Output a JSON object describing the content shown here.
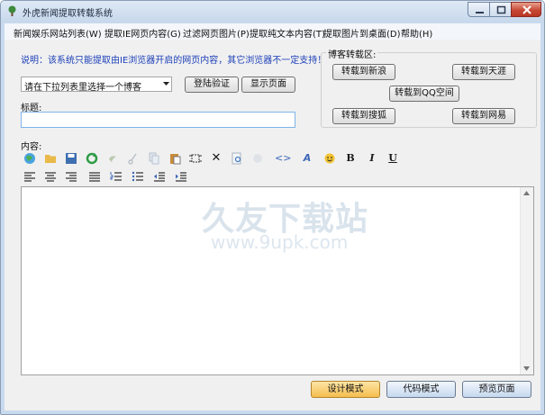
{
  "window": {
    "title": "外虎新闻提取转载系统",
    "accent_color": "#c9daee"
  },
  "menu": [
    "新闻娱乐网站列表(W)",
    "提取IE网页内容(G)",
    "过滤网页图片(P)",
    "提取纯文本内容(T)",
    "提取图片到桌面(D)",
    "帮助(H)"
  ],
  "notice": "说明：该系统只能提取由IE浏览器开启的网页内容，其它浏览器不一定支持！",
  "blog_select": {
    "selected": "请在下拉列表里选择一个博客"
  },
  "buttons": {
    "login_verify": "登陆验证",
    "show_page": "显示页面"
  },
  "title_label": "标题:",
  "title_value": "",
  "content_label": "内容:",
  "repost_group": {
    "title": "博客转载区:",
    "sina": "转载到新浪",
    "tianya": "转载到天涯",
    "qzone": "转载到QQ空间",
    "sohu": "转载到搜狐",
    "netease": "转载到网易"
  },
  "toolbar_icons": [
    "globe-icon",
    "open-folder-icon",
    "save-icon",
    "refresh-icon",
    "undo-icon",
    "cut-icon",
    "copy-icon",
    "paste-icon",
    "select-all-icon",
    "delete-icon",
    "find-icon",
    "image-icon",
    "source-code-icon",
    "font-style-icon",
    "emoticon-icon",
    "bold-icon",
    "italic-icon",
    "underline-icon",
    "align-left-icon",
    "align-center-icon",
    "align-right-icon",
    "justify-icon",
    "numbered-list-icon",
    "bulleted-list-icon",
    "outdent-icon",
    "indent-icon"
  ],
  "format_glyphs": {
    "bold": "B",
    "italic": "I",
    "underline": "U",
    "source": "<>",
    "font": "A",
    "delete": "✕"
  },
  "watermark": {
    "text": "久友下载站",
    "url": "www.9upk.com"
  },
  "bottom_buttons": {
    "design": "设计模式",
    "code": "代码模式",
    "preview": "预览页面"
  }
}
